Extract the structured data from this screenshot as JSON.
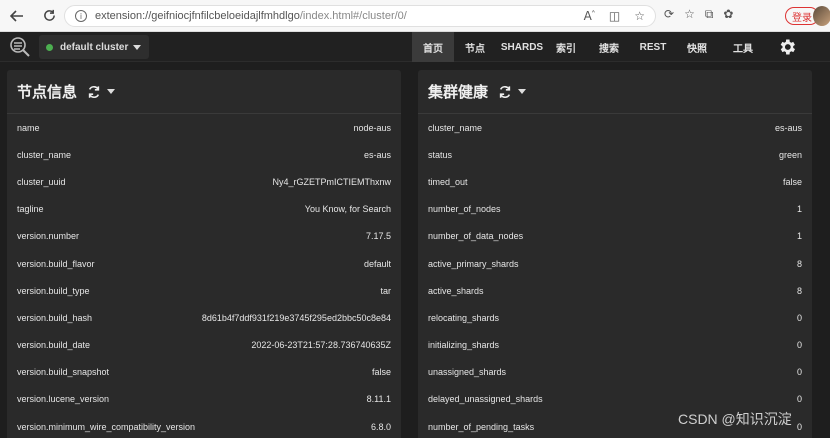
{
  "browser": {
    "url_host": "extension://geifniocjfnfilcbeloeidajlfmhdlgo",
    "url_path": "/index.html#/cluster/0/",
    "login_label": "登录"
  },
  "app": {
    "cluster_label": "default cluster",
    "status_color": "#4caf50",
    "menu": [
      {
        "label": "首页",
        "active": true
      },
      {
        "label": "节点"
      },
      {
        "label": "SHARDS"
      },
      {
        "label": "索引"
      },
      {
        "label": "搜索"
      },
      {
        "label": "REST"
      },
      {
        "label": "快照"
      },
      {
        "label": "工具"
      }
    ]
  },
  "node_panel": {
    "title": "节点信息",
    "rows": [
      {
        "key": "name",
        "value": "node-aus"
      },
      {
        "key": "cluster_name",
        "value": "es-aus"
      },
      {
        "key": "cluster_uuid",
        "value": "Ny4_rGZETPmICTIEMThxnw"
      },
      {
        "key": "tagline",
        "value": "You Know, for Search"
      },
      {
        "key": "version.number",
        "value": "7.17.5"
      },
      {
        "key": "version.build_flavor",
        "value": "default"
      },
      {
        "key": "version.build_type",
        "value": "tar"
      },
      {
        "key": "version.build_hash",
        "value": "8d61b4f7ddf931f219e3745f295ed2bbc50c8e84"
      },
      {
        "key": "version.build_date",
        "value": "2022-06-23T21:57:28.736740635Z"
      },
      {
        "key": "version.build_snapshot",
        "value": "false"
      },
      {
        "key": "version.lucene_version",
        "value": "8.11.1"
      },
      {
        "key": "version.minimum_wire_compatibility_version",
        "value": "6.8.0"
      }
    ]
  },
  "health_panel": {
    "title": "集群健康",
    "rows": [
      {
        "key": "cluster_name",
        "value": "es-aus"
      },
      {
        "key": "status",
        "value": "green"
      },
      {
        "key": "timed_out",
        "value": "false"
      },
      {
        "key": "number_of_nodes",
        "value": "1"
      },
      {
        "key": "number_of_data_nodes",
        "value": "1"
      },
      {
        "key": "active_primary_shards",
        "value": "8"
      },
      {
        "key": "active_shards",
        "value": "8"
      },
      {
        "key": "relocating_shards",
        "value": "0"
      },
      {
        "key": "initializing_shards",
        "value": "0"
      },
      {
        "key": "unassigned_shards",
        "value": "0"
      },
      {
        "key": "delayed_unassigned_shards",
        "value": "0"
      },
      {
        "key": "number_of_pending_tasks",
        "value": "0"
      }
    ]
  },
  "watermark": "CSDN @知识沉淀"
}
